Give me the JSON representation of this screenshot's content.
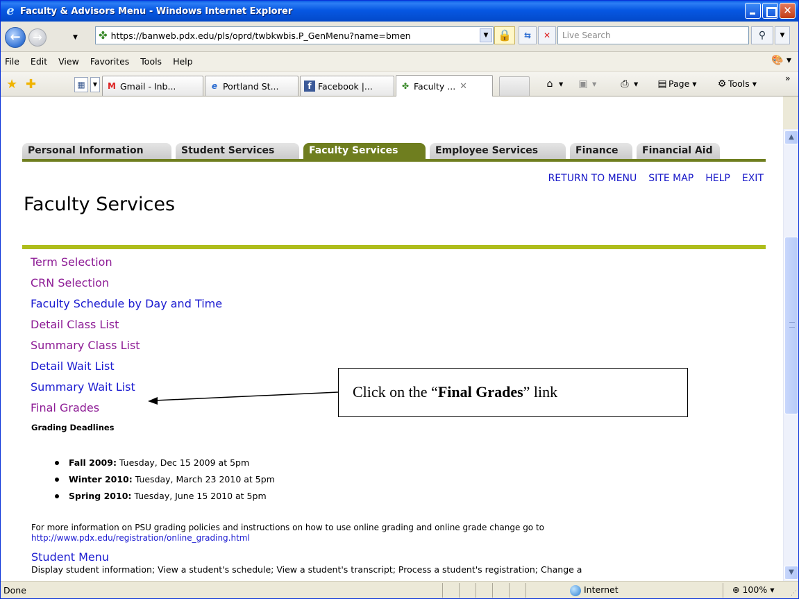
{
  "window": {
    "title": "Faculty & Advisors Menu - Windows Internet Explorer"
  },
  "address": {
    "url": "https://banweb.pdx.edu/pls/oprd/twbkwbis.P_GenMenu?name=bmen",
    "search_placeholder": "Live Search"
  },
  "menubar": {
    "items": [
      "File",
      "Edit",
      "View",
      "Favorites",
      "Tools",
      "Help"
    ]
  },
  "tabs": {
    "items": [
      "Gmail - Inb...",
      "Portland St...",
      "Facebook |...",
      "Faculty ..."
    ],
    "commands": {
      "page": "Page",
      "tools": "Tools"
    }
  },
  "page": {
    "main_tabs": [
      "Personal Information",
      "Student Services",
      "Faculty Services",
      "Employee Services",
      "Finance",
      "Financial Aid"
    ],
    "active_tab": "Faculty Services",
    "top_links": [
      "RETURN TO MENU",
      "SITE MAP",
      "HELP",
      "EXIT"
    ],
    "title": "Faculty Services",
    "menu_links": [
      "Term Selection",
      "CRN Selection",
      "Faculty Schedule by Day and Time",
      "Detail Class List",
      "Summary Class List",
      "Detail Wait List",
      "Summary Wait List",
      "Final Grades"
    ],
    "grading_title": "Grading Deadlines",
    "deadlines": [
      {
        "term": "Fall 2009:",
        "date": " Tuesday, Dec 15 2009 at 5pm"
      },
      {
        "term": "Winter 2010:",
        "date": " Tuesday, March 23 2010 at 5pm"
      },
      {
        "term": "Spring 2010:",
        "date": " Tuesday, June 15 2010 at 5pm"
      }
    ],
    "info_text": "For more information on PSU grading policies and instructions on how to use online grading and online grade change go to",
    "info_link": "http://www.pdx.edu/registration/online_grading.html",
    "student_menu": "Student Menu",
    "student_desc": "Display student information; View a student's schedule; View a student's transcript; Process a student's registration; Change a"
  },
  "callout": {
    "prefix": "Click on the “",
    "bold": "Final Grades",
    "suffix": "” link"
  },
  "status": {
    "text": "Done",
    "zone": "Internet",
    "zoom": "100%"
  },
  "colors": {
    "active_tab": "#6f7e1f",
    "rule": "#aebd1c",
    "link": "#1a1ad0",
    "visited": "#8d1b95"
  }
}
